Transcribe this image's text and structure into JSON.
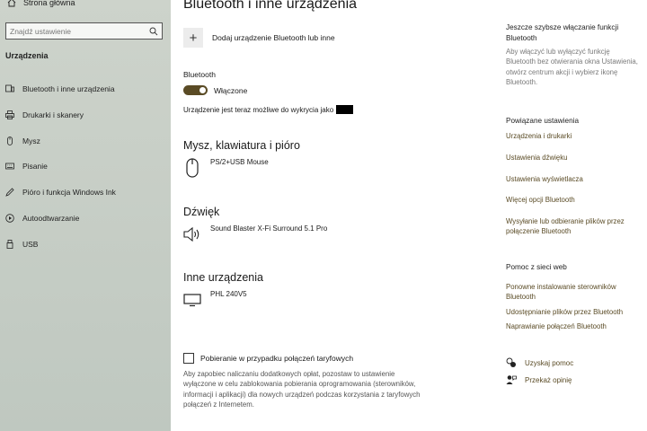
{
  "sidebar": {
    "home_label": "Strona główna",
    "search_placeholder": "Znajdź ustawienie",
    "section_title": "Urządzenia",
    "items": [
      {
        "label": "Bluetooth i inne urządzenia",
        "icon": "bluetooth-device-icon"
      },
      {
        "label": "Drukarki i skanery",
        "icon": "printer-icon"
      },
      {
        "label": "Mysz",
        "icon": "mouse-icon"
      },
      {
        "label": "Pisanie",
        "icon": "keyboard-icon"
      },
      {
        "label": "Pióro i funkcja Windows Ink",
        "icon": "pen-icon"
      },
      {
        "label": "Autoodtwarzanie",
        "icon": "autoplay-icon"
      },
      {
        "label": "USB",
        "icon": "usb-icon"
      }
    ]
  },
  "main": {
    "title": "Bluetooth i inne urządzenia",
    "add_device_label": "Dodaj urządzenie Bluetooth lub inne",
    "bluetooth_label": "Bluetooth",
    "toggle_state": "Włączone",
    "discoverable_text": "Urządzenie jest teraz możliwe do wykrycia jako",
    "sections": [
      {
        "title": "Mysz, klawiatura i pióro",
        "device": "PS/2+USB Mouse",
        "icon": "mouse-icon"
      },
      {
        "title": "Dźwięk",
        "device": "Sound Blaster X-Fi Surround 5.1 Pro",
        "icon": "speaker-icon"
      },
      {
        "title": "Inne urządzenia",
        "device": "PHL 240V5",
        "icon": "monitor-icon"
      }
    ],
    "metered_checkbox_label": "Pobieranie w przypadku połączeń taryfowych",
    "metered_description": "Aby zapobiec naliczaniu dodatkowych opłat, pozostaw to ustawienie wyłączone w celu zablokowania pobierania oprogramowania (sterowników, informacji i aplikacji) dla nowych urządzeń podczas korzystania z taryfowych połączeń z Internetem."
  },
  "right": {
    "quick_title": "Jeszcze szybsze włączanie funkcji Bluetooth",
    "quick_text": "Aby włączyć lub wyłączyć funkcję Bluetooth bez otwierania okna Ustawienia, otwórz centrum akcji i wybierz ikonę Bluetooth.",
    "related_title": "Powiązane ustawienia",
    "related_links": [
      "Urządzenia i drukarki",
      "Ustawienia dźwięku",
      "Ustawienia wyświetlacza",
      "Więcej opcji Bluetooth",
      "Wysyłanie lub odbieranie plików przez połączenie Bluetooth"
    ],
    "web_help_title": "Pomoc z sieci web",
    "web_help_links": [
      "Ponowne instalowanie sterowników Bluetooth",
      "Udostępnianie plików przez Bluetooth",
      "Naprawianie połączeń Bluetooth"
    ],
    "get_help": "Uzyskaj pomoc",
    "feedback": "Przekaż opinię"
  },
  "colors": {
    "accent": "#5a4b25",
    "sidebar_bg": "#c7cec6"
  }
}
